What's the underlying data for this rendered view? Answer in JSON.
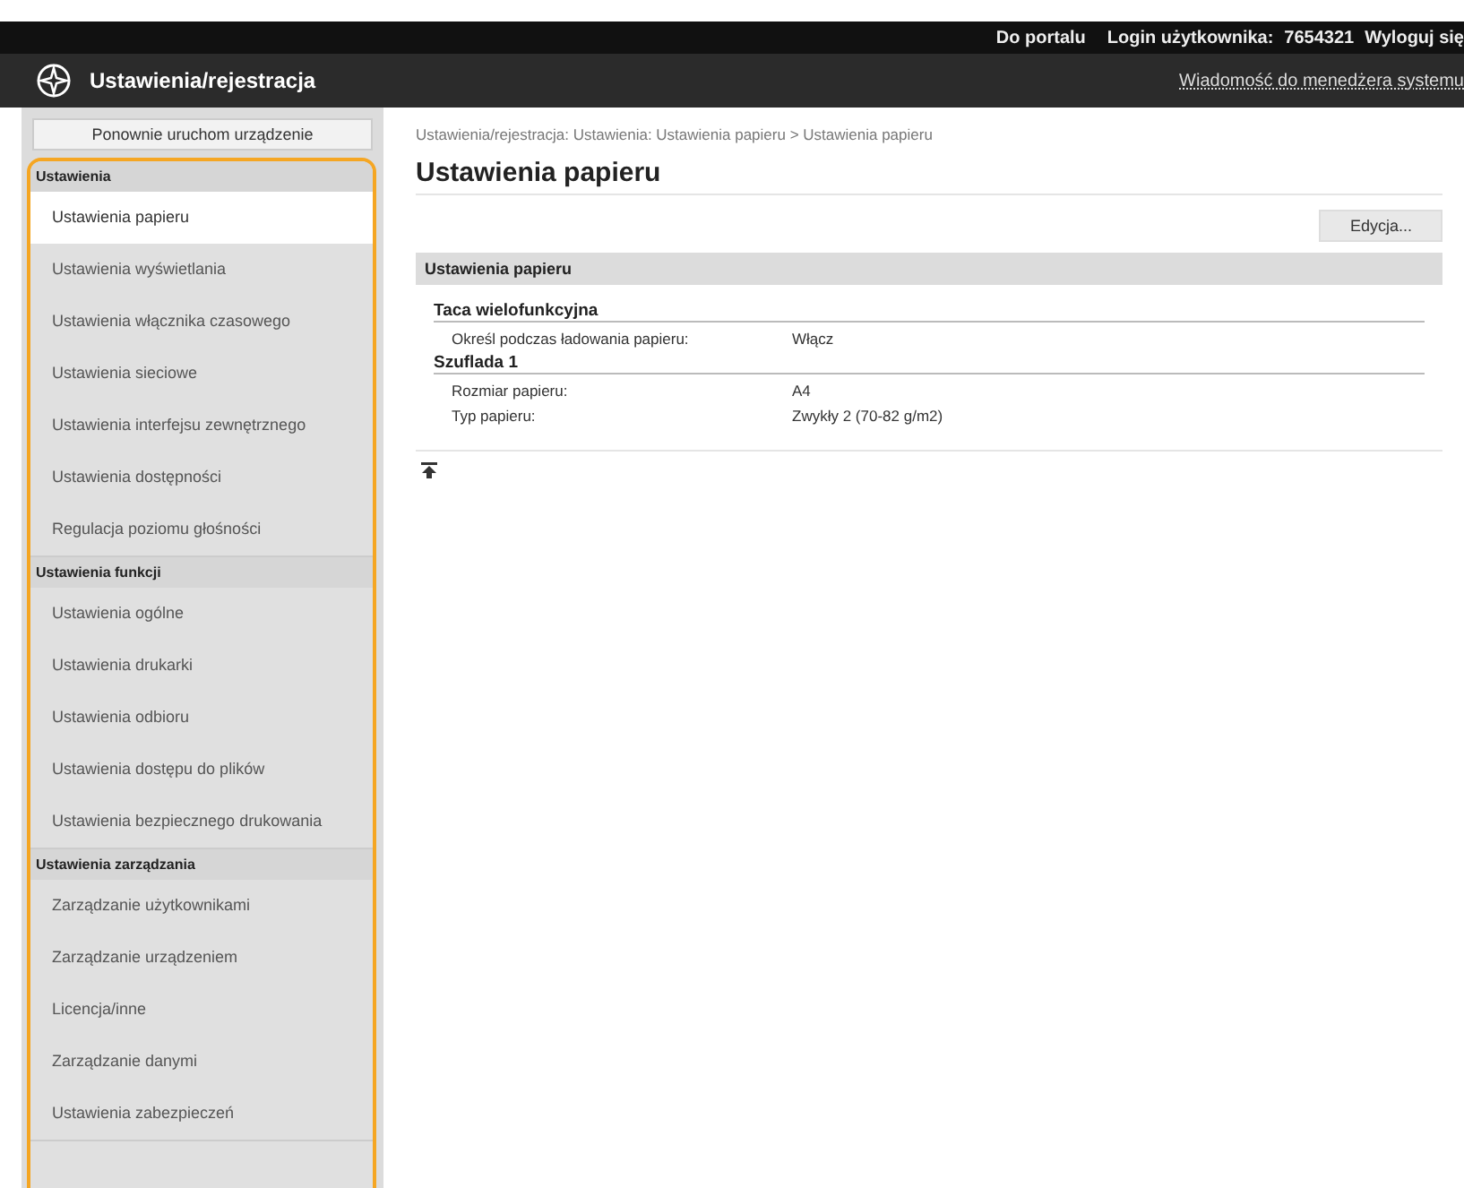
{
  "top_bar": {
    "links": [
      "Do portalu"
    ],
    "login_label": "Login użytkownika:",
    "login_value": "7654321",
    "logout": "Wyloguj się"
  },
  "header": {
    "title": "Ustawienia/rejestracja",
    "message_link": "Wiadomość do menedżera systemu"
  },
  "sidebar": {
    "restart_button": "Ponownie uruchom urządzenie",
    "sections": [
      {
        "title": "Ustawienia",
        "items": [
          {
            "label": "Ustawienia papieru",
            "selected": true
          },
          {
            "label": "Ustawienia wyświetlania",
            "selected": false
          },
          {
            "label": "Ustawienia włącznika czasowego",
            "selected": false
          },
          {
            "label": "Ustawienia sieciowe",
            "selected": false
          },
          {
            "label": "Ustawienia interfejsu zewnętrznego",
            "selected": false
          },
          {
            "label": "Ustawienia dostępności",
            "selected": false
          },
          {
            "label": "Regulacja poziomu głośności",
            "selected": false
          }
        ]
      },
      {
        "title": "Ustawienia funkcji",
        "items": [
          {
            "label": "Ustawienia ogólne",
            "selected": false
          },
          {
            "label": "Ustawienia drukarki",
            "selected": false
          },
          {
            "label": "Ustawienia odbioru",
            "selected": false
          },
          {
            "label": "Ustawienia dostępu do plików",
            "selected": false
          },
          {
            "label": "Ustawienia bezpiecznego drukowania",
            "selected": false
          }
        ]
      },
      {
        "title": "Ustawienia zarządzania",
        "items": [
          {
            "label": "Zarządzanie użytkownikami",
            "selected": false
          },
          {
            "label": "Zarządzanie urządzeniem",
            "selected": false
          },
          {
            "label": "Licencja/inne",
            "selected": false
          },
          {
            "label": "Zarządzanie danymi",
            "selected": false
          },
          {
            "label": "Ustawienia zabezpieczeń",
            "selected": false
          }
        ]
      }
    ]
  },
  "main": {
    "breadcrumb": "Ustawienia/rejestracja: Ustawienia: Ustawienia papieru > Ustawienia papieru",
    "title": "Ustawienia papieru",
    "edit_button": "Edycja...",
    "panel": {
      "title": "Ustawienia papieru",
      "groups": [
        {
          "title": "Taca wielofunkcyjna",
          "rows": [
            {
              "label": "Określ podczas ładowania papieru:",
              "value": "Włącz"
            }
          ]
        },
        {
          "title": "Szuflada 1",
          "rows": [
            {
              "label": "Rozmiar papieru:",
              "value": "A4"
            },
            {
              "label": "Typ papieru:",
              "value": "Zwykły 2 (70-82 g/m2)"
            }
          ]
        }
      ]
    }
  }
}
